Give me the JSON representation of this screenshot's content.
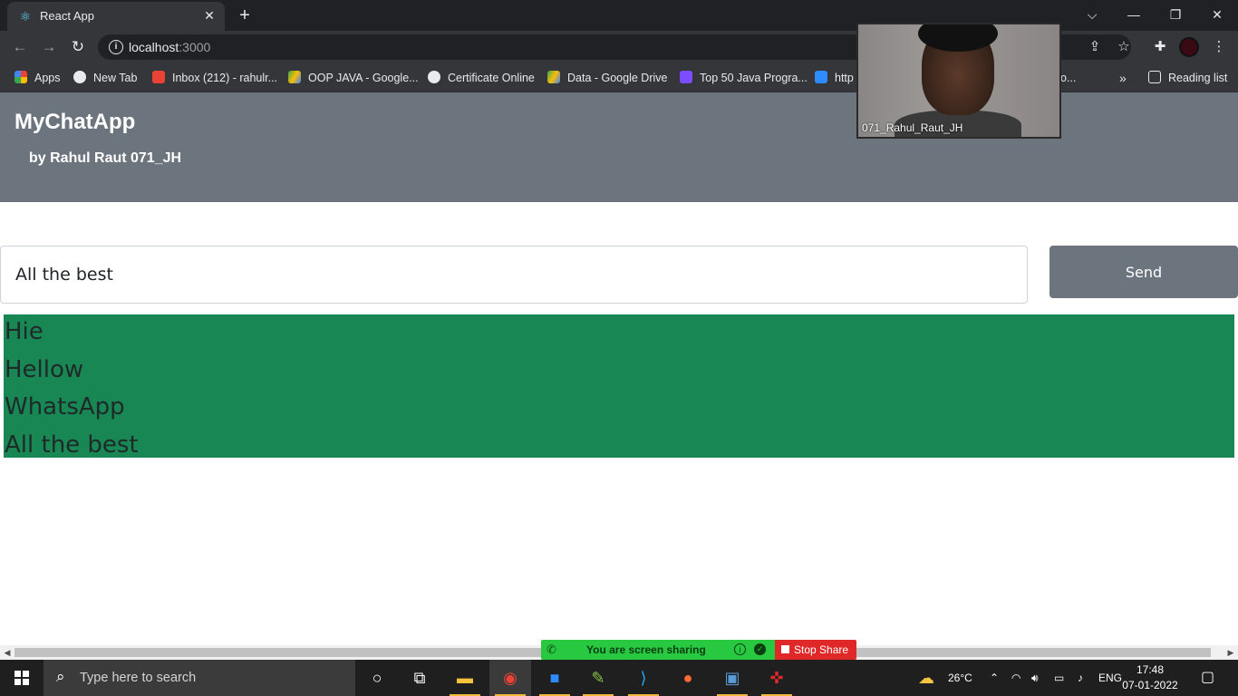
{
  "browser": {
    "tab_title": "React App",
    "url_host": "localhost",
    "url_port": ":3000",
    "reading_list": "Reading list",
    "bookmarks": [
      {
        "label": "Apps",
        "icon": "apps-grid-icon",
        "color": "#ea4335"
      },
      {
        "label": "New Tab",
        "icon": "globe-icon",
        "color": "#e8eaed"
      },
      {
        "label": "Inbox (212) - rahulr...",
        "icon": "gmail-icon",
        "color": "#ea4335"
      },
      {
        "label": "OOP JAVA - Google...",
        "icon": "drive-icon",
        "color": "#fbbc04"
      },
      {
        "label": "Certificate Online",
        "icon": "globe-icon",
        "color": "#e8eaed"
      },
      {
        "label": "Data - Google Drive",
        "icon": "drive-icon",
        "color": "#34a853"
      },
      {
        "label": "Top 50 Java Progra...",
        "icon": "d-icon",
        "color": "#7c4dff"
      },
      {
        "label": "http",
        "icon": "zoom-icon",
        "color": "#2d8cff"
      },
      {
        "label": "o...",
        "icon": "",
        "color": ""
      }
    ]
  },
  "app": {
    "brand": "MyChatApp",
    "subtitle": "by Rahul Raut 071_JH",
    "input_value": "All the best",
    "send_label": "Send",
    "messages": [
      "Hie",
      "Hellow",
      "WhatsApp",
      "All the best"
    ],
    "header_color": "#6c757d",
    "messages_bg": "#198754"
  },
  "video": {
    "participant": "071_Rahul_Raut_JH"
  },
  "share": {
    "status": "You are screen sharing",
    "stop_label": "Stop Share"
  },
  "taskbar": {
    "search_placeholder": "Type here to search",
    "weather": "26°C",
    "language": "ENG",
    "time": "17:48",
    "date": "07-01-2022"
  }
}
